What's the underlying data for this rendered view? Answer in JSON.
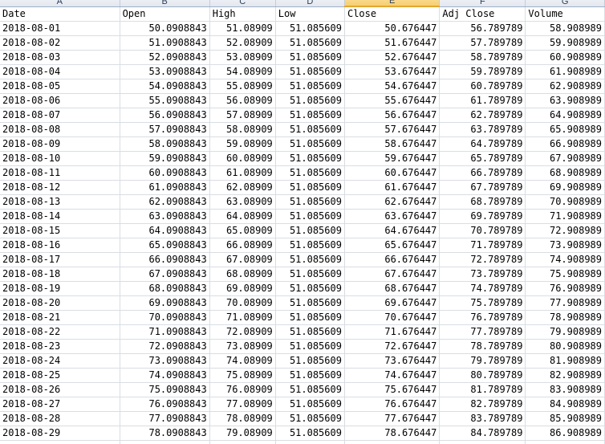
{
  "column_letters": [
    "A",
    "B",
    "C",
    "D",
    "E",
    "F",
    "G"
  ],
  "selected_column": "E",
  "headers": [
    "Date",
    "Open",
    "High",
    "Low",
    "Close",
    "Adj Close",
    "Volume"
  ],
  "rows": [
    [
      "2018-08-01",
      "50.0908843",
      "51.08909",
      "51.085609",
      "50.676447",
      "56.789789",
      "58.908989"
    ],
    [
      "2018-08-02",
      "51.0908843",
      "52.08909",
      "51.085609",
      "51.676447",
      "57.789789",
      "59.908989"
    ],
    [
      "2018-08-03",
      "52.0908843",
      "53.08909",
      "51.085609",
      "52.676447",
      "58.789789",
      "60.908989"
    ],
    [
      "2018-08-04",
      "53.0908843",
      "54.08909",
      "51.085609",
      "53.676447",
      "59.789789",
      "61.908989"
    ],
    [
      "2018-08-05",
      "54.0908843",
      "55.08909",
      "51.085609",
      "54.676447",
      "60.789789",
      "62.908989"
    ],
    [
      "2018-08-06",
      "55.0908843",
      "56.08909",
      "51.085609",
      "55.676447",
      "61.789789",
      "63.908989"
    ],
    [
      "2018-08-07",
      "56.0908843",
      "57.08909",
      "51.085609",
      "56.676447",
      "62.789789",
      "64.908989"
    ],
    [
      "2018-08-08",
      "57.0908843",
      "58.08909",
      "51.085609",
      "57.676447",
      "63.789789",
      "65.908989"
    ],
    [
      "2018-08-09",
      "58.0908843",
      "59.08909",
      "51.085609",
      "58.676447",
      "64.789789",
      "66.908989"
    ],
    [
      "2018-08-10",
      "59.0908843",
      "60.08909",
      "51.085609",
      "59.676447",
      "65.789789",
      "67.908989"
    ],
    [
      "2018-08-11",
      "60.0908843",
      "61.08909",
      "51.085609",
      "60.676447",
      "66.789789",
      "68.908989"
    ],
    [
      "2018-08-12",
      "61.0908843",
      "62.08909",
      "51.085609",
      "61.676447",
      "67.789789",
      "69.908989"
    ],
    [
      "2018-08-13",
      "62.0908843",
      "63.08909",
      "51.085609",
      "62.676447",
      "68.789789",
      "70.908989"
    ],
    [
      "2018-08-14",
      "63.0908843",
      "64.08909",
      "51.085609",
      "63.676447",
      "69.789789",
      "71.908989"
    ],
    [
      "2018-08-15",
      "64.0908843",
      "65.08909",
      "51.085609",
      "64.676447",
      "70.789789",
      "72.908989"
    ],
    [
      "2018-08-16",
      "65.0908843",
      "66.08909",
      "51.085609",
      "65.676447",
      "71.789789",
      "73.908989"
    ],
    [
      "2018-08-17",
      "66.0908843",
      "67.08909",
      "51.085609",
      "66.676447",
      "72.789789",
      "74.908989"
    ],
    [
      "2018-08-18",
      "67.0908843",
      "68.08909",
      "51.085609",
      "67.676447",
      "73.789789",
      "75.908989"
    ],
    [
      "2018-08-19",
      "68.0908843",
      "69.08909",
      "51.085609",
      "68.676447",
      "74.789789",
      "76.908989"
    ],
    [
      "2018-08-20",
      "69.0908843",
      "70.08909",
      "51.085609",
      "69.676447",
      "75.789789",
      "77.908989"
    ],
    [
      "2018-08-21",
      "70.0908843",
      "71.08909",
      "51.085609",
      "70.676447",
      "76.789789",
      "78.908989"
    ],
    [
      "2018-08-22",
      "71.0908843",
      "72.08909",
      "51.085609",
      "71.676447",
      "77.789789",
      "79.908989"
    ],
    [
      "2018-08-23",
      "72.0908843",
      "73.08909",
      "51.085609",
      "72.676447",
      "78.789789",
      "80.908989"
    ],
    [
      "2018-08-24",
      "73.0908843",
      "74.08909",
      "51.085609",
      "73.676447",
      "79.789789",
      "81.908989"
    ],
    [
      "2018-08-25",
      "74.0908843",
      "75.08909",
      "51.085609",
      "74.676447",
      "80.789789",
      "82.908989"
    ],
    [
      "2018-08-26",
      "75.0908843",
      "76.08909",
      "51.085609",
      "75.676447",
      "81.789789",
      "83.908989"
    ],
    [
      "2018-08-27",
      "76.0908843",
      "77.08909",
      "51.085609",
      "76.676447",
      "82.789789",
      "84.908989"
    ],
    [
      "2018-08-28",
      "77.0908843",
      "78.08909",
      "51.085609",
      "77.676447",
      "83.789789",
      "85.908989"
    ],
    [
      "2018-08-29",
      "78.0908843",
      "79.08909",
      "51.085609",
      "78.676447",
      "84.789789",
      "86.908989"
    ]
  ]
}
